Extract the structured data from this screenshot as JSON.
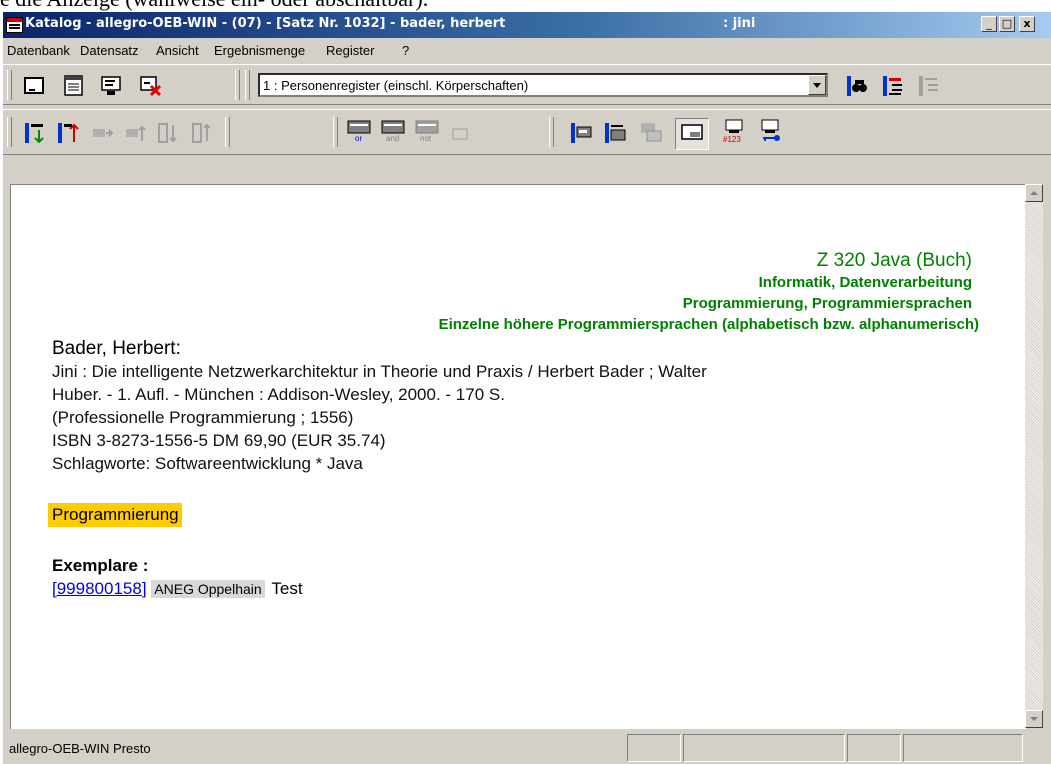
{
  "fragment_text": "e die Anzeige (wahlweise ein- oder abschaltbar).",
  "window": {
    "title": "Katalog - allegro-OEB-WIN - (07) - [Satz Nr. 1032] - bader, herbert",
    "user": ": jini",
    "controls": [
      "_",
      "□",
      "x"
    ]
  },
  "menu": [
    "Datenbank",
    "Datensatz",
    "Ansicht",
    "Ergebnismenge",
    "Register",
    "?"
  ],
  "register_combo": {
    "value": "1 : Personenregister (einschl. Körperschaften)"
  },
  "toolbar_icons": {
    "row1": [
      "new-record-icon",
      "record-list-icon",
      "edit-record-icon",
      "delete-record-icon",
      "binoculars-icon",
      "index-tree-icon",
      "index-tree-disabled-icon"
    ],
    "row2": [
      "next-record-icon",
      "previous-record-icon",
      "right-arrow-disabled-icon",
      "up-arrow-disabled-icon",
      "sort-down-disabled-icon",
      "sort-up-disabled-icon",
      "or-combine-icon",
      "and-combine-icon",
      "not-combine-icon",
      "small-box-disabled-icon",
      "display-format-1-icon",
      "display-format-2-icon",
      "display-format-3-icon",
      "display-format-4-icon",
      "number-search-icon",
      "key-search-icon"
    ],
    "combine_labels": [
      "or",
      "and",
      "not"
    ],
    "number_label": "#123"
  },
  "record": {
    "notation": "Z 320 Java (Buch)",
    "classification": [
      "Informatik, Datenverarbeitung",
      "Programmierung, Programmiersprachen",
      "Einzelne höhere Programmiersprachen (alphabetisch bzw. alphanumerisch)"
    ],
    "author": "Bader, Herbert:",
    "lines": [
      "Jini : Die intelligente Netzwerkarchitektur in Theorie und Praxis / Herbert Bader ; Walter",
      "Huber. - 1. Aufl. - München : Addison-Wesley, 2000. - 170 S.",
      "(Professionelle Programmierung ; 1556)",
      "ISBN 3-8273-1556-5  DM 69,90 (EUR 35.74)",
      "Schlagworte: Softwareentwicklung  * Java"
    ],
    "tag": "Programmierung",
    "tag_color": "#ffcc00",
    "copies_label": "Exemplare :",
    "copy": {
      "id": "[999800158]",
      "branch": "ANEG Oppelhain",
      "note": "Test"
    }
  },
  "status_text": "allegro-OEB-WIN Presto",
  "colors": {
    "heading_green": "#008000",
    "link_blue": "#0000ee",
    "titlebar": "#0a246a"
  }
}
